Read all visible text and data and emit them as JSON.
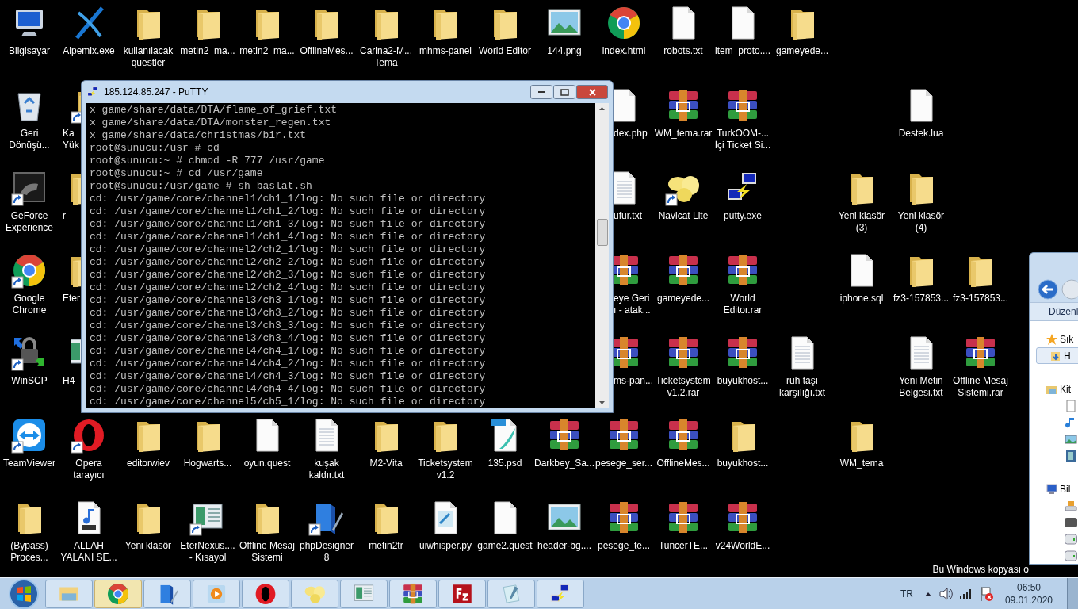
{
  "desktop_icons": [
    {
      "label": "Bilgisayar",
      "kind": "computer",
      "shortcut": false
    },
    {
      "label": "Alpemix.exe",
      "kind": "alpemix",
      "shortcut": false
    },
    {
      "label": "kullanılacak\nquestler",
      "kind": "folder",
      "shortcut": false
    },
    {
      "label": "metin2_ma...",
      "kind": "folder",
      "shortcut": false
    },
    {
      "label": "metin2_ma...",
      "kind": "folder",
      "shortcut": false
    },
    {
      "label": "OfflineMes...",
      "kind": "folder",
      "shortcut": false
    },
    {
      "label": "Carina2-M...\nTema",
      "kind": "folder",
      "shortcut": false
    },
    {
      "label": "mhms-panel",
      "kind": "folder",
      "shortcut": false
    },
    {
      "label": "World Editor",
      "kind": "folder",
      "shortcut": false
    },
    {
      "label": "144.png",
      "kind": "image",
      "shortcut": false
    },
    {
      "label": "index.html",
      "kind": "chrome",
      "shortcut": false
    },
    {
      "label": "robots.txt",
      "kind": "doc",
      "shortcut": false
    },
    {
      "label": "item_proto....",
      "kind": "doc",
      "shortcut": false
    },
    {
      "label": "gameyede...",
      "kind": "folder",
      "shortcut": false
    },
    {
      "label": "Geri\nDönüşü...",
      "kind": "recycle",
      "shortcut": false
    },
    {
      "label": "Ka\nYük",
      "kind": "folder",
      "shortcut": true
    },
    {
      "label": "dex.php",
      "kind": "doc",
      "shortcut": false
    },
    {
      "label": "WM_tema.rar",
      "kind": "rar",
      "shortcut": false
    },
    {
      "label": "TurkOOM-...\nİçi Ticket Si...",
      "kind": "rar",
      "shortcut": false
    },
    {
      "label": "Destek.lua",
      "kind": "doc",
      "shortcut": false
    },
    {
      "label": "GeForce\nExperience",
      "kind": "geforce",
      "shortcut": true
    },
    {
      "label": "r",
      "kind": "folder",
      "shortcut": false
    },
    {
      "label": "ufur.txt",
      "kind": "text",
      "shortcut": false
    },
    {
      "label": "Navicat Lite",
      "kind": "navicat",
      "shortcut": true
    },
    {
      "label": "putty.exe",
      "kind": "putty",
      "shortcut": false
    },
    {
      "label": "Yeni klasör\n(3)",
      "kind": "folder",
      "shortcut": false
    },
    {
      "label": "Yeni klasör\n(4)",
      "kind": "folder",
      "shortcut": false
    },
    {
      "label": "Google\nChrome",
      "kind": "chrome",
      "shortcut": true
    },
    {
      "label": "Eter",
      "kind": "folder",
      "shortcut": false
    },
    {
      "label": "eye Geri\nı - atak...",
      "kind": "rar",
      "shortcut": false
    },
    {
      "label": "gameyede...",
      "kind": "rar",
      "shortcut": false
    },
    {
      "label": "World\nEditor.rar",
      "kind": "rar",
      "shortcut": false
    },
    {
      "label": "iphone.sql",
      "kind": "doc",
      "shortcut": false
    },
    {
      "label": "fz3-157853...",
      "kind": "folder",
      "shortcut": false
    },
    {
      "label": "fz3-157853...",
      "kind": "folder",
      "shortcut": false
    },
    {
      "label": "WinSCP",
      "kind": "winscp",
      "shortcut": true
    },
    {
      "label": "H4",
      "kind": "app",
      "shortcut": false
    },
    {
      "label": "ms-pan...",
      "kind": "rar",
      "shortcut": false
    },
    {
      "label": "Ticketsystem\nv1.2.rar",
      "kind": "rar",
      "shortcut": false
    },
    {
      "label": "buyukhost...",
      "kind": "rar",
      "shortcut": false
    },
    {
      "label": "ruh taşı\nkarşılığı.txt",
      "kind": "text",
      "shortcut": false
    },
    {
      "label": "Yeni Metin\nBelgesi.txt",
      "kind": "text",
      "shortcut": false
    },
    {
      "label": "Offline Mesaj\nSistemi.rar",
      "kind": "rar",
      "shortcut": false
    },
    {
      "label": "TeamViewer",
      "kind": "teamviewer",
      "shortcut": true
    },
    {
      "label": "Opera\ntarayıcı",
      "kind": "opera",
      "shortcut": true
    },
    {
      "label": "editorwiev",
      "kind": "folder",
      "shortcut": false
    },
    {
      "label": "Hogwarts...",
      "kind": "folder",
      "shortcut": false
    },
    {
      "label": "oyun.quest",
      "kind": "doc",
      "shortcut": false
    },
    {
      "label": "kuşak\nkaldır.txt",
      "kind": "text",
      "shortcut": false
    },
    {
      "label": "M2-Vita",
      "kind": "folder",
      "shortcut": false
    },
    {
      "label": "Ticketsystem\nv1.2",
      "kind": "folder",
      "shortcut": false
    },
    {
      "label": "135.psd",
      "kind": "psd",
      "shortcut": false
    },
    {
      "label": "Darkbey_Sa...",
      "kind": "rar",
      "shortcut": false
    },
    {
      "label": "pesege_ser...",
      "kind": "rar",
      "shortcut": false
    },
    {
      "label": "OfflineMes...",
      "kind": "rar",
      "shortcut": false
    },
    {
      "label": "buyukhost...",
      "kind": "folder",
      "shortcut": false
    },
    {
      "label": "WM_tema",
      "kind": "folder",
      "shortcut": false
    },
    {
      "label": "(Bypass)\nProces...",
      "kind": "folder",
      "shortcut": false
    },
    {
      "label": "ALLAH\nYALANI SE...",
      "kind": "mp3",
      "shortcut": false
    },
    {
      "label": "Yeni klasör",
      "kind": "folder",
      "shortcut": false
    },
    {
      "label": "EterNexus....\n- Kısayol",
      "kind": "app",
      "shortcut": true
    },
    {
      "label": "Offline Mesaj\nSistemi",
      "kind": "folder",
      "shortcut": false
    },
    {
      "label": "phpDesigner\n8",
      "kind": "book",
      "shortcut": true
    },
    {
      "label": "metin2tr",
      "kind": "folder",
      "shortcut": false
    },
    {
      "label": "uiwhisper.py",
      "kind": "python",
      "shortcut": false
    },
    {
      "label": "game2.quest",
      "kind": "doc",
      "shortcut": false
    },
    {
      "label": "header-bg....",
      "kind": "image",
      "shortcut": false
    },
    {
      "label": "pesege_te...",
      "kind": "rar",
      "shortcut": false
    },
    {
      "label": "TuncerTE...",
      "kind": "rar",
      "shortcut": false
    },
    {
      "label": "v24WorldE...",
      "kind": "rar",
      "shortcut": false
    }
  ],
  "putty": {
    "title": "185.124.85.247 - PuTTY",
    "lines": [
      "x game/share/data/DTA/flame_of_grief.txt",
      "x game/share/data/DTA/monster_regen.txt",
      "x game/share/data/christmas/bir.txt",
      "root@sunucu:/usr # cd",
      "root@sunucu:~ # chmod -R 777 /usr/game",
      "root@sunucu:~ # cd /usr/game",
      "root@sunucu:/usr/game # sh baslat.sh",
      "cd: /usr/game/core/channel1/ch1_1/log: No such file or directory",
      "cd: /usr/game/core/channel1/ch1_2/log: No such file or directory",
      "cd: /usr/game/core/channel1/ch1_3/log: No such file or directory",
      "cd: /usr/game/core/channel1/ch1_4/log: No such file or directory",
      "cd: /usr/game/core/channel2/ch2_1/log: No such file or directory",
      "cd: /usr/game/core/channel2/ch2_2/log: No such file or directory",
      "cd: /usr/game/core/channel2/ch2_3/log: No such file or directory",
      "cd: /usr/game/core/channel2/ch2_4/log: No such file or directory",
      "cd: /usr/game/core/channel3/ch3_1/log: No such file or directory",
      "cd: /usr/game/core/channel3/ch3_2/log: No such file or directory",
      "cd: /usr/game/core/channel3/ch3_3/log: No such file or directory",
      "cd: /usr/game/core/channel3/ch3_4/log: No such file or directory",
      "cd: /usr/game/core/channel4/ch4_1/log: No such file or directory",
      "cd: /usr/game/core/channel4/ch4_2/log: No such file or directory",
      "cd: /usr/game/core/channel4/ch4_3/log: No such file or directory",
      "cd: /usr/game/core/channel4/ch4_4/log: No such file or directory",
      "cd: /usr/game/core/channel5/ch5_1/log: No such file or directory"
    ]
  },
  "explorer": {
    "toolbar_label": "Düzenl",
    "nav": [
      {
        "kind": "star",
        "text": "Sık",
        "selected": false,
        "children": [
          {
            "kind": "folder-down",
            "text": "H",
            "selected": true
          }
        ]
      },
      {
        "kind": "library",
        "text": "Kit",
        "selected": false,
        "children": [
          {
            "kind": "doc",
            "selected": false
          },
          {
            "kind": "music",
            "selected": false
          },
          {
            "kind": "picture",
            "selected": false
          },
          {
            "kind": "video",
            "selected": false
          }
        ]
      },
      {
        "kind": "computer",
        "text": "Bil",
        "selected": false,
        "children": [
          {
            "kind": "drive-win",
            "selected": false
          },
          {
            "kind": "drive-dark",
            "selected": false
          },
          {
            "kind": "drive",
            "selected": false
          },
          {
            "kind": "drive",
            "selected": false
          }
        ]
      }
    ]
  },
  "activation_notice": "Bu Windows kopyası o",
  "taskbar": {
    "items": [
      {
        "kind": "explorer",
        "selected": false
      },
      {
        "kind": "chrome",
        "selected": true
      },
      {
        "kind": "book",
        "selected": false
      },
      {
        "kind": "media",
        "selected": false
      },
      {
        "kind": "opera",
        "selected": false
      },
      {
        "kind": "navicat",
        "selected": false
      },
      {
        "kind": "app",
        "selected": false
      },
      {
        "kind": "rar",
        "selected": false
      },
      {
        "kind": "filezilla",
        "selected": false
      },
      {
        "kind": "notepad",
        "selected": false
      },
      {
        "kind": "putty",
        "selected": false
      }
    ],
    "language": "TR",
    "time": "06:50",
    "date": "09.01.2020"
  }
}
